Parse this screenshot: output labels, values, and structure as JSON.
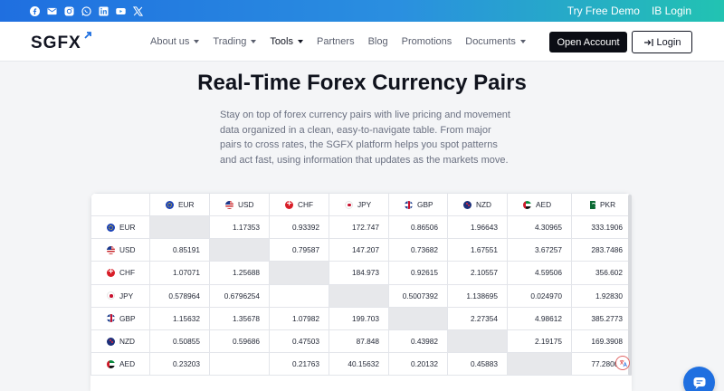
{
  "topbar": {
    "social_icons": [
      "facebook-icon",
      "email-icon",
      "instagram-icon",
      "whatsapp-icon",
      "linkedin-icon",
      "youtube-icon",
      "x-icon"
    ],
    "links": [
      {
        "label": "Try Free Demo"
      },
      {
        "label": "IB Login"
      }
    ],
    "gradient_colors": [
      "#1f6fe0",
      "#22c3b2"
    ]
  },
  "nav": {
    "logo": "SGFX",
    "menu": [
      {
        "label": "About us",
        "has_dropdown": true
      },
      {
        "label": "Trading",
        "has_dropdown": true
      },
      {
        "label": "Tools",
        "has_dropdown": true,
        "active": true
      },
      {
        "label": "Partners",
        "has_dropdown": false
      },
      {
        "label": "Blog",
        "has_dropdown": false
      },
      {
        "label": "Promotions",
        "has_dropdown": false
      },
      {
        "label": "Documents",
        "has_dropdown": true
      }
    ],
    "open_account_label": "Open Account",
    "login_label": "Login"
  },
  "hero": {
    "title": "Real-Time Forex Currency Pairs",
    "description": "Stay on top of forex currency pairs with live pricing and movement data organized in a clean, easy-to-navigate table. From major pairs to cross rates, the SGFX platform helps you spot patterns and act fast, using information that updates as the markets move."
  },
  "table": {
    "columns": [
      "EUR",
      "USD",
      "CHF",
      "JPY",
      "GBP",
      "NZD",
      "AED",
      "PKR"
    ],
    "rows": [
      {
        "currency": "EUR",
        "values": [
          "",
          "1.17353",
          "0.93392",
          "172.747",
          "0.86506",
          "1.96643",
          "4.30965",
          "333.1906"
        ]
      },
      {
        "currency": "USD",
        "values": [
          "0.85191",
          "",
          "0.79587",
          "147.207",
          "0.73682",
          "1.67551",
          "3.67257",
          "283.7486"
        ]
      },
      {
        "currency": "CHF",
        "values": [
          "1.07071",
          "1.25688",
          "",
          "184.973",
          "0.92615",
          "2.10557",
          "4.59506",
          "356.602"
        ]
      },
      {
        "currency": "JPY",
        "values": [
          "0.578964",
          "0.6796254",
          "",
          "",
          "0.5007392",
          "1.138695",
          "0.024970",
          "1.92830"
        ]
      },
      {
        "currency": "GBP",
        "values": [
          "1.15632",
          "1.35678",
          "1.07982",
          "199.703",
          "",
          "2.27354",
          "4.98612",
          "385.2773"
        ]
      },
      {
        "currency": "NZD",
        "values": [
          "0.50855",
          "0.59686",
          "0.47503",
          "87.848",
          "0.43982",
          "",
          "2.19175",
          "169.3908"
        ]
      },
      {
        "currency": "AED",
        "values": [
          "0.23203",
          "",
          "0.21763",
          "40.15632",
          "0.20132",
          "0.45883",
          "",
          "77.28006"
        ]
      }
    ],
    "diagonal_color": "#e7e8eb"
  },
  "widgets": {
    "chat_icon": "chat-bubble-icon",
    "chat_color": "#1f6fe0"
  }
}
